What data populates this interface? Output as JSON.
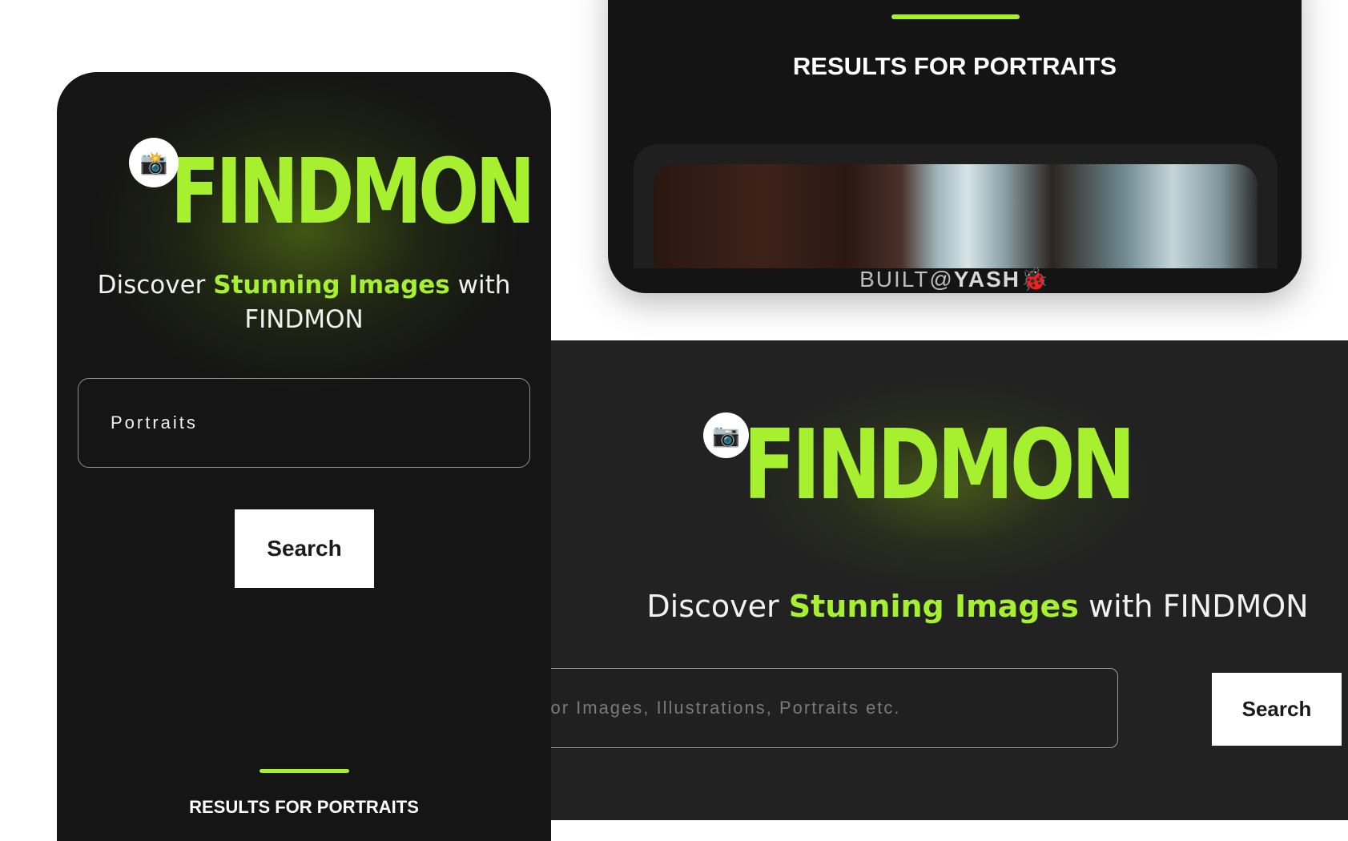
{
  "brand": {
    "name": "FINDMON",
    "camera_icon": "camera-icon",
    "accent_color": "#a6f02f"
  },
  "tagline": {
    "prefix": "Discover ",
    "highlight": "Stunning Images",
    "suffix": " with FINDMON"
  },
  "mobile": {
    "search_value": "Portraits",
    "search_button": "Search",
    "results_heading": "RESULTS FOR PORTRAITS"
  },
  "desktop": {
    "search_placeholder": "Search for Images, Illustrations, Portraits etc.",
    "search_placeholder_visible": "ch for Images, Illustrations, Portraits etc.",
    "search_button": "Search"
  },
  "results": {
    "heading": "RESULTS FOR PORTRAITS",
    "footer_prefix": "BUILT@",
    "footer_name": "YASH",
    "footer_icon": "ladybug-icon"
  }
}
